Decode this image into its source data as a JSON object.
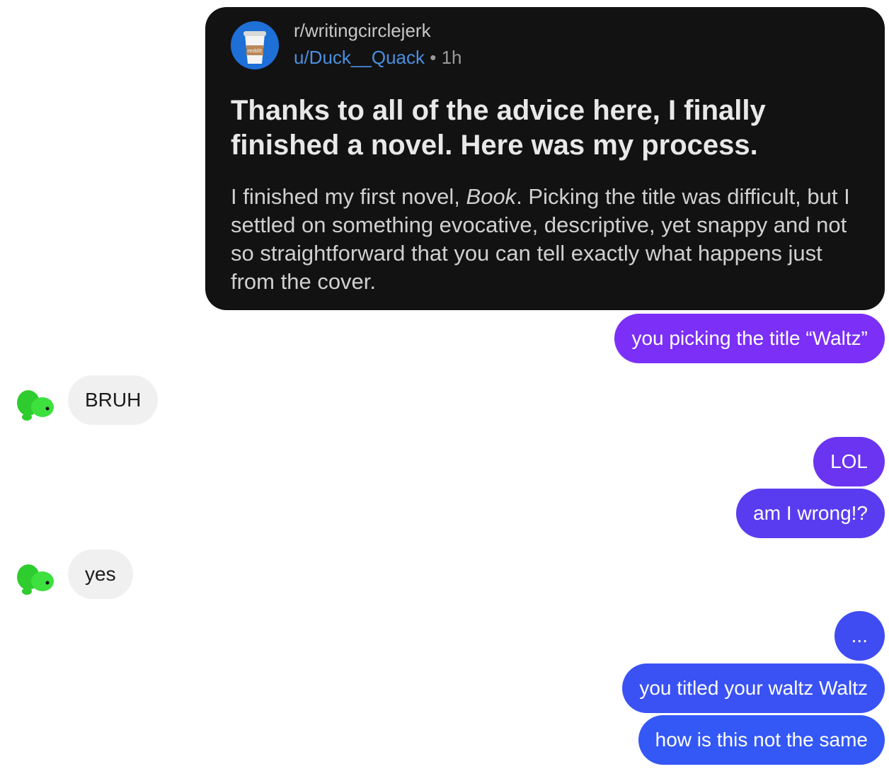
{
  "post": {
    "subreddit": "r/writingcirclejerk",
    "avatar_label": "reddit",
    "user": "u/Duck__Quack",
    "separator": "•",
    "age": "1h",
    "title": "Thanks to all of the advice here, I finally finished a novel. Here was my process.",
    "body_before": "I finished my first novel, ",
    "body_italic": "Book",
    "body_after": ". Picking the title was difficult, but I settled on something evocative, descriptive, yet snappy and not so straightforward that you can tell exactly what happens just from the cover."
  },
  "messages": [
    {
      "side": "out",
      "text": "you picking the title “Waltz”",
      "color": "#7b2ff7"
    },
    {
      "side": "in",
      "text": "BRUH"
    },
    {
      "side": "out",
      "text": "LOL",
      "color": "#6a34f0"
    },
    {
      "side": "out",
      "text": "am I wrong!?",
      "color": "#5a3cf0"
    },
    {
      "side": "in",
      "text": "yes"
    },
    {
      "side": "out",
      "text": "...",
      "color": "#3f4cf2"
    },
    {
      "side": "out",
      "text": "you titled your waltz Waltz",
      "color": "#3a52f4"
    },
    {
      "side": "out",
      "text": "how is this not the same",
      "color": "#3458f5"
    }
  ],
  "contact_avatar_icon": "turtle-icon",
  "colors": {
    "incoming_bubble": "#f0f0f0",
    "card_bg": "#121212",
    "link": "#4a90e2"
  }
}
